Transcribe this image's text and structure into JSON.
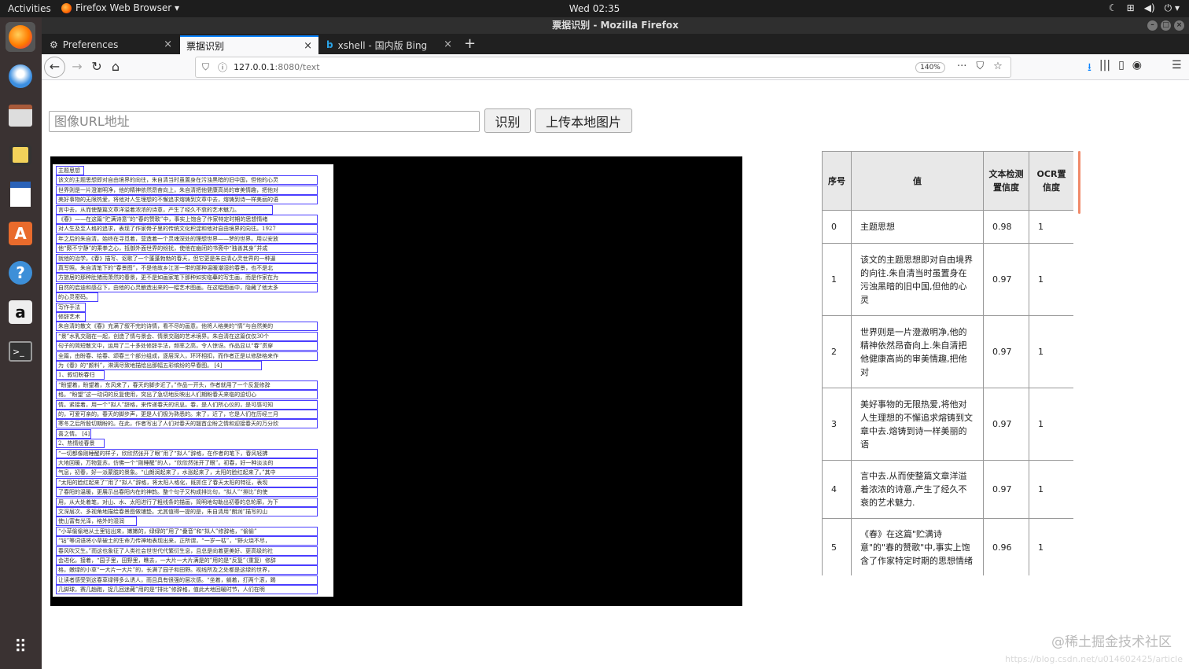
{
  "topbar": {
    "activities": "Activities",
    "app_menu": "Firefox Web Browser ▾",
    "clock": "Wed 02:35",
    "tray_icons": [
      "night-light-icon",
      "network-icon",
      "volume-icon",
      "power-icon"
    ]
  },
  "dock": {
    "items": [
      "firefox-icon",
      "thunderbird-icon",
      "files-icon",
      "rhythmbox-icon",
      "writer-icon",
      "software-icon",
      "help-icon",
      "amazon-icon",
      "terminal-icon",
      "app-grid-icon"
    ]
  },
  "window": {
    "title": "票据识别 - Mozilla Firefox"
  },
  "tabs": [
    {
      "label": "Preferences",
      "icon": "gear-icon",
      "active": false
    },
    {
      "label": "票据识别",
      "icon": "",
      "active": true
    },
    {
      "label": "xshell - 国内版 Bing",
      "icon": "bing-icon",
      "active": false
    }
  ],
  "navbar": {
    "url_host": "127.0.0.1",
    "url_rest": ":8080/text",
    "zoom": "140%"
  },
  "form": {
    "url_placeholder": "图像URL地址",
    "recognize_label": "识别",
    "upload_label": "上传本地图片"
  },
  "document_lines": [
    "主题思想",
    "该文的主题思想即对自由境界的向往，朱自清当时虽置身在污浊黑暗的旧中国，但他的心灵",
    "世界则是一片澄澈明净，他的精神依然昂奋向上，朱自清把他健康高尚的审美情趣，把他对",
    "美好事物的无限热爱，将他对人生理想的不懈追求熔铸到文章中去，熔铸到诗一样美丽的语",
    "言中去，从而使整篇文章洋溢着浓浓的诗意，产生了经久不衰的艺术魅力。",
    "《春》——在这篇“贮满诗意”的“春的赞歌”中，事实上饱含了作家特定时期的思想情绪",
    "对人生及至人格的追求，表现了作家骨子里的传统文化积淀和他对自由境界的向往。1927",
    "年之后的朱自清，始终在寻觅着，营造着一个灵魂深处的理想世界——梦的世界。用以安放",
    "他“颇不宁静”的乘拳之心，抵御外面世界的纷扰，使他在幽闭的书斋中“独善其身”并成",
    "就他的治学。《春》描写、讴歌了一个蓬蓬勃勃的春天，但它更是朱自清心灵世界的一种逼",
    "真写照。朱自清笔下的“春景图”，不是他故乡江浙一带的那种温暖潮湿的春景，也不是北",
    "方旅居的那种肚猪而萧然的春景，更不是如画家笔下那种如实临摹的写生画，而是作家在为",
    "自然的启迪和感召下，由他的心灵酿造出来的一幅艺术图画。在这幅图画中，隐藏了他太多",
    "的心灵密码。",
    "写作手法",
    "修辞艺术",
    "朱自清的散文《春》充满了叙不完的诗情，看不尽的画意。他将人格美的“情”与自然美的",
    "“景”水乳交融在一起，创造了情与景会、情景交融的艺术境界。朱自清在这篇仅仅30个",
    "句子的简短散文中，运用了二十多处修辞手法，频率之高，令人惊讶。作品显以“春”贯穿",
    "全篇，由盼春、绘春、颂春三个部分组成，逐层深入，环环相扣，而作者正是以修辞格来作",
    "为《春》的“颜料”，淋漓尽致地描绘出那幅五彩缤纷的早春图。 [4]",
    "1、叙切盼春归",
    "“盼望着，盼望着，东风来了，春天的脚步近了。”作品一开头，作者就用了一个反复修辞",
    "格。“盼望”这一动词的反复使用，突出了急切地反映出人们期盼春天来临的迫切心",
    "情。紧接着，用一个“拟人”辞格，来传递春天的讯息。春，是人们所心仪的，是可感可知",
    "的，可爱可亲的。春天的脚步声，更是人们极为熟悉的。来了，近了，它是人们在历经三月",
    "寒冬之后所殷切期盼的。在此，作者写出了人们对春天的翘首企盼之情和迎接春天的万分欣",
    "喜之情。 [4]",
    "2、热情绘春景",
    "“一切都像刚睡醒的样子，欣欣然张开了眼”用了“拟人”辞格，在作者的笔下，春风轻拂",
    "大地回暖，万物复苏，仿佛一个“刚睡醒”的人，“欣欣然张开了眼”。初春，好一种淡淡的",
    "气息，初春，好一派蒙胧的景象。“山朗润起来了，水涨起来了，太阳的脸红起来了。”其中",
    "“太阳的脸红起来了”用了“拟人”辞格，将太阳人格化，既抓住了春天太阳的特征，表现",
    "了春阳的温暖，更展示出春阳内在的神韵。整个句子又构成排比句，“拟人”“排比”的使",
    "用，从大处着笔，对山、水、太阳进行了粗线条的描画，简明地勾勒出初春的总轮廓，为下",
    "文深层次、多视角地描绘春景图做铺垫。尤其值得一提的是，朱自清用“朗润”描写的山",
    "使山富有光泽，格外的湿润",
    "“小草偷偷地从土里钻出来，嫩嫩的，绿绿的”用了“叠音”和“拟人”修辞格，“偷偷”",
    "“钻”等词语将小草破土的生命力传神地表现出来，正所谓，“一岁一枯”，“野火烧不尽，",
    "春风吹又生。”而这也象征了人类社会世世代代繁衍生息，且总是向着更美好、更高级的社",
    "会进化。接着，“园子里，田野里，瞧去，一大片一大片满是的”用的是“反复”（重复）修辞",
    "格，嫩绿的小草“一大片一大片”的，长满了园子和田野。视线所及之处都是这绿的世界，",
    "让读者感受到这春草绿得多么诱人，而且具有很强的层次感。“坐着，躺着，打两个滚，踢",
    "几脚球，赛几趟跑，捉几回迷藏”用的是“排比”修辞格，值此大地回暖时节，人们在明"
  ],
  "table": {
    "headers": [
      "序号",
      "值",
      "文本检测置信度",
      "OCR置信度"
    ],
    "rows": [
      [
        "0",
        "主题思想",
        "0.98",
        "1"
      ],
      [
        "1",
        "该文的主题思想即对自由境界的向往.朱自清当时虽置身在污浊黑暗的旧中国,但他的心灵",
        "0.97",
        "1"
      ],
      [
        "2",
        "世界则是一片澄澈明净,他的精神依然昂奋向上.朱自清把他健康高尚的审美情趣,把他对",
        "0.97",
        "1"
      ],
      [
        "3",
        "美好事物的无限热爱,将他对人生理想的不懈追求熔铸到文章中去.熔铸到诗一样美丽的语",
        "0.97",
        "1"
      ],
      [
        "4",
        "言中去.从而使整篇文章洋溢着浓浓的诗意,产生了经久不衰的艺术魅力.",
        "0.97",
        "1"
      ],
      [
        "5",
        "《春》在这篇\"贮满诗意\"的\"春的赞歌\"中,事实上饱含了作家特定时期的思想情绪",
        "0.96",
        "1"
      ]
    ]
  },
  "watermark": "@稀土掘金技术社区",
  "watermark_url": "https://blog.csdn.net/u014602425/article"
}
